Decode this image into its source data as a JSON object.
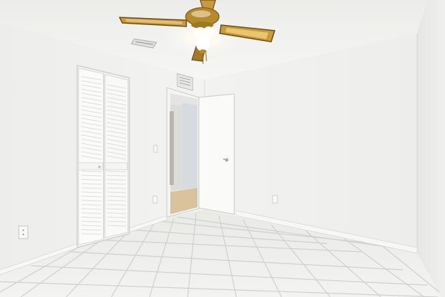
{
  "scene": {
    "subject": "empty-bedroom-interior",
    "elements": [
      "ceiling-fan",
      "bifold-louvered-closet-door",
      "open-interior-door",
      "hallway",
      "hvac-vent",
      "ceiling-vent",
      "wall-outlet",
      "light-switch",
      "tile-floor",
      "baseboard"
    ],
    "colors": {
      "ceiling": "#f1f1ef",
      "left_wall": "#eeeeec",
      "back_wall": "#f3f3f1",
      "right_wall": "#ebebe9",
      "floor": "#eeeeeb",
      "grout": "#cfcfcb",
      "fan_blade_wood": "#c89a3a",
      "fan_brass": "#b48a2c",
      "hall_floor": "#d9c39c"
    }
  }
}
